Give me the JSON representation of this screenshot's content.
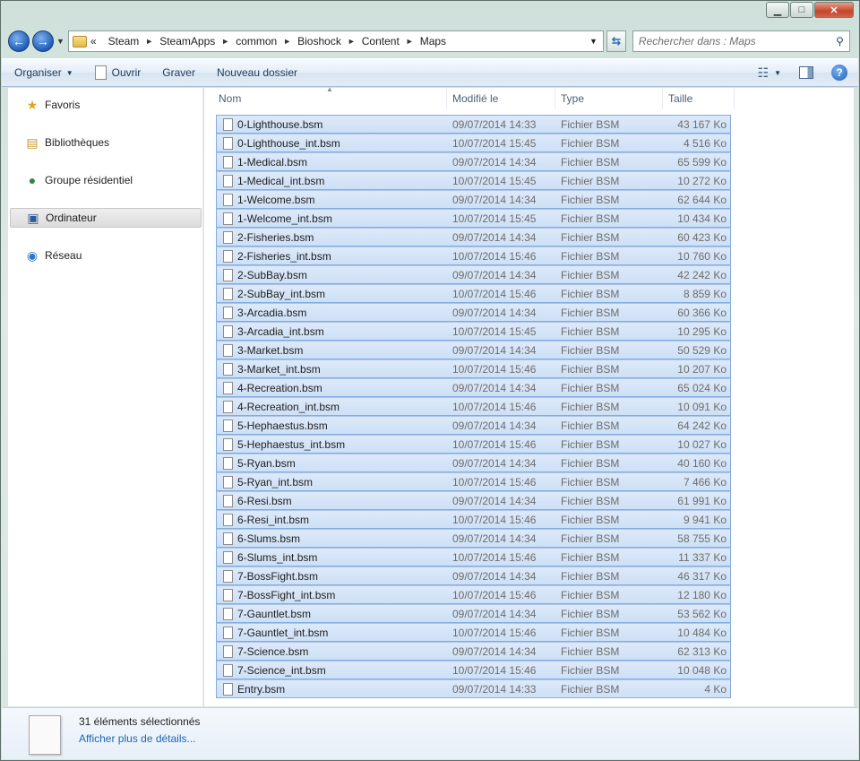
{
  "window": {
    "minimize_glyph": "▁",
    "maximize_glyph": "□",
    "close_glyph": "✕"
  },
  "address": {
    "overflow": "«",
    "crumbs": [
      "Steam",
      "SteamApps",
      "common",
      "Bioshock",
      "Content",
      "Maps"
    ],
    "search_placeholder": "Rechercher dans : Maps"
  },
  "toolbar": {
    "organiser": "Organiser",
    "ouvrir": "Ouvrir",
    "graver": "Graver",
    "nouveau_dossier": "Nouveau dossier"
  },
  "sidebar": {
    "items": [
      {
        "label": "Favoris",
        "icon": "star-icon"
      },
      {
        "label": "Bibliothèques",
        "icon": "libraries-icon"
      },
      {
        "label": "Groupe résidentiel",
        "icon": "homegroup-icon"
      },
      {
        "label": "Ordinateur",
        "icon": "computer-icon"
      },
      {
        "label": "Réseau",
        "icon": "network-icon"
      }
    ]
  },
  "columns": {
    "name": "Nom",
    "modified": "Modifié le",
    "type": "Type",
    "size": "Taille"
  },
  "files": [
    {
      "name": "0-Lighthouse.bsm",
      "date": "09/07/2014 14:33",
      "type": "Fichier BSM",
      "size": "43 167 Ko"
    },
    {
      "name": "0-Lighthouse_int.bsm",
      "date": "10/07/2014 15:45",
      "type": "Fichier BSM",
      "size": "4 516 Ko"
    },
    {
      "name": "1-Medical.bsm",
      "date": "09/07/2014 14:34",
      "type": "Fichier BSM",
      "size": "65 599 Ko"
    },
    {
      "name": "1-Medical_int.bsm",
      "date": "10/07/2014 15:45",
      "type": "Fichier BSM",
      "size": "10 272 Ko"
    },
    {
      "name": "1-Welcome.bsm",
      "date": "09/07/2014 14:34",
      "type": "Fichier BSM",
      "size": "62 644 Ko"
    },
    {
      "name": "1-Welcome_int.bsm",
      "date": "10/07/2014 15:45",
      "type": "Fichier BSM",
      "size": "10 434 Ko"
    },
    {
      "name": "2-Fisheries.bsm",
      "date": "09/07/2014 14:34",
      "type": "Fichier BSM",
      "size": "60 423 Ko"
    },
    {
      "name": "2-Fisheries_int.bsm",
      "date": "10/07/2014 15:46",
      "type": "Fichier BSM",
      "size": "10 760 Ko"
    },
    {
      "name": "2-SubBay.bsm",
      "date": "09/07/2014 14:34",
      "type": "Fichier BSM",
      "size": "42 242 Ko"
    },
    {
      "name": "2-SubBay_int.bsm",
      "date": "10/07/2014 15:46",
      "type": "Fichier BSM",
      "size": "8 859 Ko"
    },
    {
      "name": "3-Arcadia.bsm",
      "date": "09/07/2014 14:34",
      "type": "Fichier BSM",
      "size": "60 366 Ko"
    },
    {
      "name": "3-Arcadia_int.bsm",
      "date": "10/07/2014 15:45",
      "type": "Fichier BSM",
      "size": "10 295 Ko"
    },
    {
      "name": "3-Market.bsm",
      "date": "09/07/2014 14:34",
      "type": "Fichier BSM",
      "size": "50 529 Ko"
    },
    {
      "name": "3-Market_int.bsm",
      "date": "10/07/2014 15:46",
      "type": "Fichier BSM",
      "size": "10 207 Ko"
    },
    {
      "name": "4-Recreation.bsm",
      "date": "09/07/2014 14:34",
      "type": "Fichier BSM",
      "size": "65 024 Ko"
    },
    {
      "name": "4-Recreation_int.bsm",
      "date": "10/07/2014 15:46",
      "type": "Fichier BSM",
      "size": "10 091 Ko"
    },
    {
      "name": "5-Hephaestus.bsm",
      "date": "09/07/2014 14:34",
      "type": "Fichier BSM",
      "size": "64 242 Ko"
    },
    {
      "name": "5-Hephaestus_int.bsm",
      "date": "10/07/2014 15:46",
      "type": "Fichier BSM",
      "size": "10 027 Ko"
    },
    {
      "name": "5-Ryan.bsm",
      "date": "09/07/2014 14:34",
      "type": "Fichier BSM",
      "size": "40 160 Ko"
    },
    {
      "name": "5-Ryan_int.bsm",
      "date": "10/07/2014 15:46",
      "type": "Fichier BSM",
      "size": "7 466 Ko"
    },
    {
      "name": "6-Resi.bsm",
      "date": "09/07/2014 14:34",
      "type": "Fichier BSM",
      "size": "61 991 Ko"
    },
    {
      "name": "6-Resi_int.bsm",
      "date": "10/07/2014 15:46",
      "type": "Fichier BSM",
      "size": "9 941 Ko"
    },
    {
      "name": "6-Slums.bsm",
      "date": "09/07/2014 14:34",
      "type": "Fichier BSM",
      "size": "58 755 Ko"
    },
    {
      "name": "6-Slums_int.bsm",
      "date": "10/07/2014 15:46",
      "type": "Fichier BSM",
      "size": "11 337 Ko"
    },
    {
      "name": "7-BossFight.bsm",
      "date": "09/07/2014 14:34",
      "type": "Fichier BSM",
      "size": "46 317 Ko"
    },
    {
      "name": "7-BossFight_int.bsm",
      "date": "10/07/2014 15:46",
      "type": "Fichier BSM",
      "size": "12 180 Ko"
    },
    {
      "name": "7-Gauntlet.bsm",
      "date": "09/07/2014 14:34",
      "type": "Fichier BSM",
      "size": "53 562 Ko"
    },
    {
      "name": "7-Gauntlet_int.bsm",
      "date": "10/07/2014 15:46",
      "type": "Fichier BSM",
      "size": "10 484 Ko"
    },
    {
      "name": "7-Science.bsm",
      "date": "09/07/2014 14:34",
      "type": "Fichier BSM",
      "size": "62 313 Ko"
    },
    {
      "name": "7-Science_int.bsm",
      "date": "10/07/2014 15:46",
      "type": "Fichier BSM",
      "size": "10 048 Ko"
    },
    {
      "name": "Entry.bsm",
      "date": "09/07/2014 14:33",
      "type": "Fichier BSM",
      "size": "4 Ko"
    }
  ],
  "details": {
    "selection": "31 éléments sélectionnés",
    "more": "Afficher plus de détails..."
  }
}
